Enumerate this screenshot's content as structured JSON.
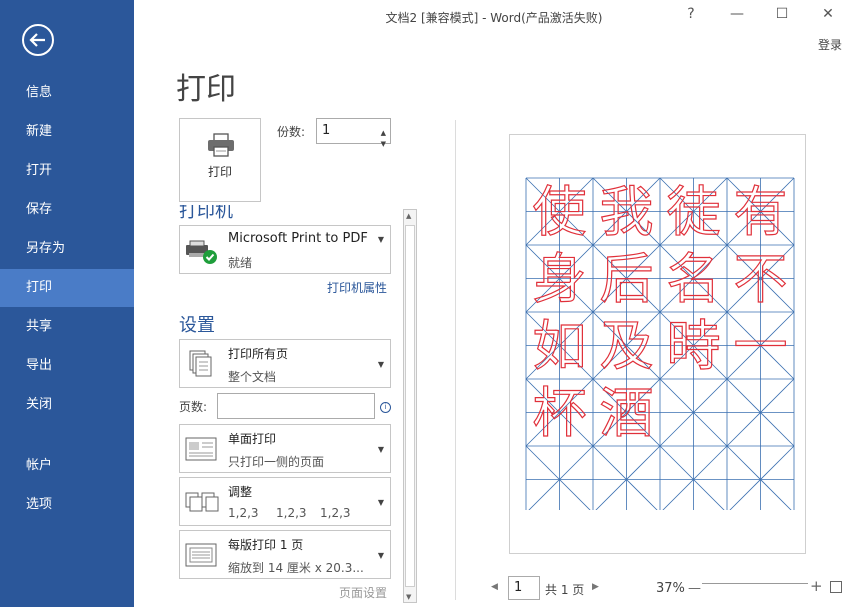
{
  "window": {
    "title": "文档2 [兼容模式] - Word(产品激活失败)",
    "help": "?",
    "minimize": "—",
    "maximize": "☐",
    "close": "✕",
    "login": "登录"
  },
  "sidebar": {
    "items": [
      {
        "label": "信息"
      },
      {
        "label": "新建"
      },
      {
        "label": "打开"
      },
      {
        "label": "保存"
      },
      {
        "label": "另存为"
      },
      {
        "label": "打印",
        "active": true
      },
      {
        "label": "共享"
      },
      {
        "label": "导出"
      },
      {
        "label": "关闭"
      },
      {
        "label": "帐户"
      },
      {
        "label": "选项"
      }
    ]
  },
  "print": {
    "page_title": "打印",
    "print_button": "打印",
    "copies_label": "份数:",
    "copies_value": "1",
    "printer_heading": "打印机",
    "printer_name": "Microsoft Print to PDF",
    "printer_status": "就绪",
    "printer_properties": "打印机属性",
    "settings_heading": "设置",
    "pages_option": {
      "main": "打印所有页",
      "sub": "整个文档"
    },
    "pages_label": "页数:",
    "pages_value": "",
    "sides_option": {
      "main": "单面打印",
      "sub": "只打印一侧的页面"
    },
    "collate_option": {
      "main": "调整",
      "sub": [
        "1,2,3",
        "1,2,3",
        "1,2,3"
      ]
    },
    "per_sheet_option": {
      "main": "每版打印 1 页",
      "sub": "缩放到 14 厘米 x 20.3..."
    },
    "page_setup": "页面设置"
  },
  "preview": {
    "rows": [
      [
        "使",
        "我",
        "徒",
        "有"
      ],
      [
        "身",
        "后",
        "名",
        "不"
      ],
      [
        "如",
        "及",
        "時",
        "一"
      ],
      [
        "杯",
        "酒",
        "",
        ""
      ]
    ],
    "grid_color": "#3a6fb0",
    "text_color": "#e0303a",
    "current_page": "1",
    "total_pages": "共 1 页",
    "zoom": "37%"
  }
}
